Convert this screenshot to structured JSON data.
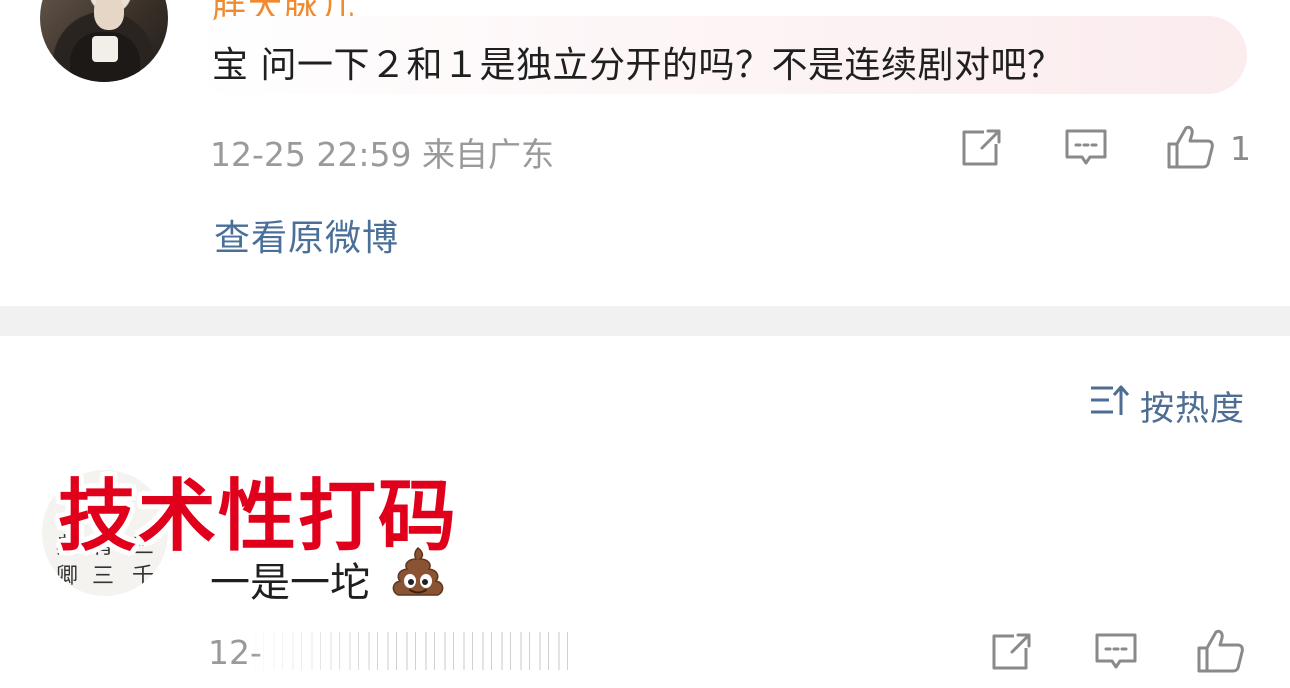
{
  "comment_1": {
    "username": "胖大脉儿",
    "text": "宝 问一下２和１是独立分开的吗？不是连续剧对吧？",
    "meta": "12-25 22:59  来自广东",
    "like_count": "1",
    "view_original_label": "查看原微博"
  },
  "sort": {
    "label": "按热度"
  },
  "watermark": {
    "text": "技术性打码"
  },
  "comment_2": {
    "avatar_calligraphy": [
      "典",
      "育",
      "三",
      "卿",
      "三",
      "千"
    ],
    "username_partial": "",
    "text": "一是一坨",
    "emoji": "poop-emoji",
    "meta": "12-"
  },
  "icons": [
    "share-icon",
    "comment-icon",
    "like-icon",
    "sort-icon"
  ],
  "colors": {
    "link_blue": "#4a6f99",
    "watermark_red": "#e0001b",
    "username_orange": "#f08a30",
    "meta_gray": "#9a9a9a"
  }
}
